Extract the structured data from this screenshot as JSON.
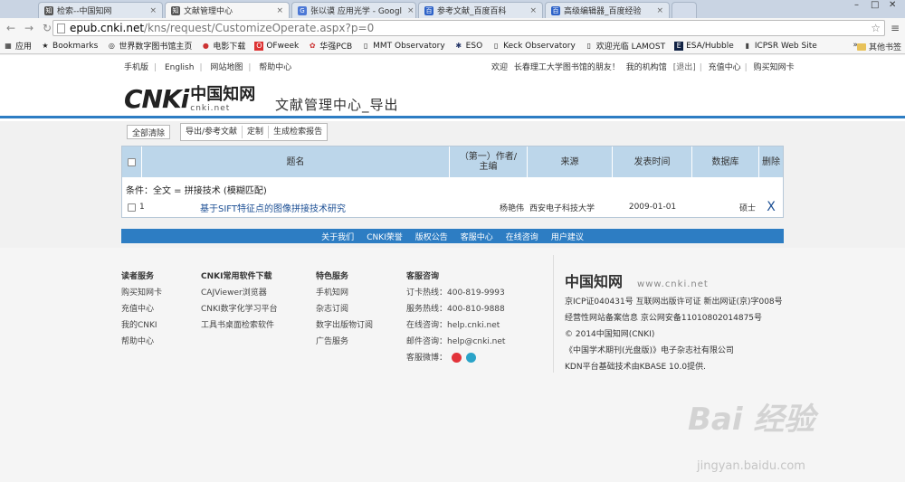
{
  "tabs": [
    {
      "label": "检索--中国知网",
      "fav": "cnki"
    },
    {
      "label": "文献管理中心",
      "fav": "cnki",
      "active": true
    },
    {
      "label": "张以谟 应用光学 - Googl",
      "fav": "g"
    },
    {
      "label": "参考文献_百度百科",
      "fav": "baidu"
    },
    {
      "label": "高级编辑器_百度经验",
      "fav": "baidu"
    }
  ],
  "address": {
    "host": "epub.cnki.net",
    "path": "/kns/request/CustomizeOperate.aspx?p=0"
  },
  "bookmarks": [
    {
      "label": "应用",
      "icon": "apps-icon"
    },
    {
      "label": "Bookmarks",
      "icon": "star-icon"
    },
    {
      "label": "世界数字图书馆主页",
      "icon": "globe-icon"
    },
    {
      "label": "电影下载",
      "icon": "film-icon"
    },
    {
      "label": "OFweek",
      "icon": "of-icon"
    },
    {
      "label": "华强PCB",
      "icon": "pcb-icon"
    },
    {
      "label": "MMT Observatory",
      "icon": "page-icon"
    },
    {
      "label": "ESO",
      "icon": "eso-icon"
    },
    {
      "label": "Keck Observatory",
      "icon": "page-icon"
    },
    {
      "label": "欢迎光临 LAMOST",
      "icon": "page-icon"
    },
    {
      "label": "ESA/Hubble",
      "icon": "esa-icon"
    },
    {
      "label": "ICPSR Web Site",
      "icon": "icpsr-icon"
    }
  ],
  "bookmarks_more": "»",
  "bookmarks_other": "其他书签",
  "topnav": {
    "left": [
      "手机版",
      "English",
      "网站地图",
      "帮助中心"
    ],
    "welcome": "欢迎",
    "user": "长春理工大学图书馆",
    "friend": "的朋友！",
    "my": "我的机构馆",
    "logout": "[退出]",
    "recharge": "充值中心",
    "buy": "购买知网卡"
  },
  "logo": {
    "cnki": "CNKi",
    "zh": "中国知网",
    "en": "cnki.net"
  },
  "page_title": "文献管理中心_导出",
  "toolbar": {
    "clear": "全部清除",
    "export": "导出/参考文献",
    "custom": "定制",
    "report": "生成检索报告"
  },
  "table": {
    "headers": [
      "",
      "题名",
      "（第一）作者/主编",
      "来源",
      "发表时间",
      "数据库",
      "删除"
    ],
    "condition": "条件：全文 = 拼接技术 (模糊匹配)",
    "rows": [
      {
        "num": "1",
        "title": "基于SIFT特征点的图像拼接技术研究",
        "author": "杨艳伟",
        "source": "西安电子科技大学",
        "date": "2009-01-01",
        "db": "硕士",
        "del": "X"
      }
    ]
  },
  "footbar": [
    "关于我们",
    "CNKI荣誉",
    "版权公告",
    "客服中心",
    "在线咨询",
    "用户建议"
  ],
  "footer": {
    "col1": {
      "head": "读者服务",
      "items": [
        "购买知网卡",
        "充值中心",
        "我的CNKI",
        "帮助中心"
      ]
    },
    "col2": {
      "head": "CNKI常用软件下载",
      "items": [
        "CAJViewer浏览器",
        "CNKI数字化学习平台",
        "工具书桌面检索软件"
      ]
    },
    "col3": {
      "head": "特色服务",
      "items": [
        "手机知网",
        "杂志订阅",
        "数字出版物订阅",
        "广告服务"
      ]
    },
    "col4": {
      "head": "客服咨询",
      "items": [
        "订卡热线：400-819-9993",
        "服务热线：400-810-9888",
        "在线咨询：help.cnki.net",
        "邮件咨询：help@cnki.net",
        "客服微博："
      ]
    },
    "right": {
      "logo_zh": "中国知网",
      "logo_en": "www.cnki.net",
      "lines": [
        "京ICP证040431号 互联网出版许可证 新出网证(京)字008号",
        "经营性网站备案信息 京公网安备11010802014875号",
        "© 2014中国知网(CNKI)",
        "《中国学术期刊(光盘版)》电子杂志社有限公司",
        "KDN平台基础技术由KBASE 10.0提供."
      ]
    }
  },
  "watermark": {
    "main": "Bai 经验",
    "sub": "jingyan.baidu.com"
  }
}
